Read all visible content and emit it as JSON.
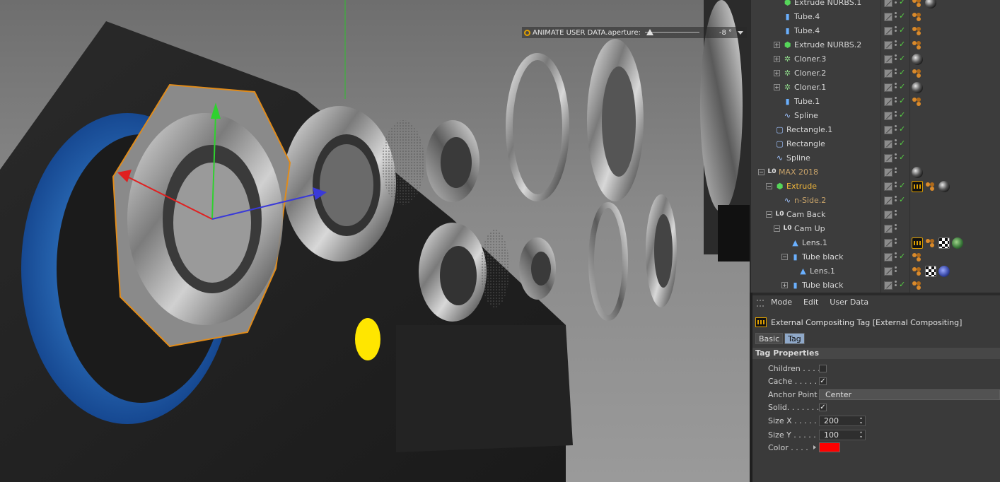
{
  "hud": {
    "label": "ANIMATE USER DATA.aperture:",
    "value": "-8 °",
    "slider_fraction": 0.02
  },
  "object_manager": {
    "rows": [
      {
        "name": "Extrude NURBS.1",
        "indent": 1,
        "icon": "extrude-icon",
        "expand": "",
        "check": true,
        "tags": [
          "dots",
          "sphere"
        ]
      },
      {
        "name": "Tube.4",
        "indent": 1,
        "icon": "tube-icon",
        "expand": "",
        "check": true,
        "tags": [
          "dots"
        ]
      },
      {
        "name": "Tube.4",
        "indent": 1,
        "icon": "tube-icon",
        "expand": "",
        "check": true,
        "tags": [
          "dots"
        ]
      },
      {
        "name": "Extrude NURBS.2",
        "indent": 1,
        "icon": "extrude-icon",
        "expand": "+",
        "check": true,
        "tags": [
          "dots"
        ]
      },
      {
        "name": "Cloner.3",
        "indent": 1,
        "icon": "cloner-icon",
        "expand": "+",
        "check": true,
        "tags": [
          "sphere"
        ]
      },
      {
        "name": "Cloner.2",
        "indent": 1,
        "icon": "cloner-icon",
        "expand": "+",
        "check": true,
        "tags": [
          "dots"
        ]
      },
      {
        "name": "Cloner.1",
        "indent": 1,
        "icon": "cloner-icon",
        "expand": "+",
        "check": true,
        "tags": [
          "sphere"
        ]
      },
      {
        "name": "Tube.1",
        "indent": 1,
        "icon": "tube-icon",
        "expand": "",
        "check": true,
        "tags": [
          "dots"
        ]
      },
      {
        "name": "Spline",
        "indent": 1,
        "icon": "spline-icon",
        "expand": "",
        "check": true,
        "tags": []
      },
      {
        "name": "Rectangle.1",
        "indent": 0,
        "icon": "rectangle-icon",
        "expand": "",
        "check": true,
        "tags": []
      },
      {
        "name": "Rectangle",
        "indent": 0,
        "icon": "rectangle-icon",
        "expand": "",
        "check": true,
        "tags": []
      },
      {
        "name": "Spline",
        "indent": 0,
        "icon": "spline-icon",
        "expand": "",
        "check": true,
        "tags": []
      },
      {
        "name": "MAX 2018",
        "indent": -1,
        "icon": "null-icon",
        "expand": "−",
        "check": false,
        "tags": [
          "sphere"
        ],
        "style": "dim"
      },
      {
        "name": "Extrude",
        "indent": 0,
        "icon": "extrude-icon",
        "expand": "−",
        "check": true,
        "tags": [
          "comp",
          "dots",
          "sphere"
        ],
        "style": "highlight"
      },
      {
        "name": "n-Side.2",
        "indent": 1,
        "icon": "spline-icon",
        "expand": "",
        "check": true,
        "tags": [],
        "style": "dim"
      },
      {
        "name": "Cam Back",
        "indent": 0,
        "icon": "null-icon",
        "expand": "−",
        "check": false,
        "tags": []
      },
      {
        "name": "Cam Up",
        "indent": 1,
        "icon": "null-icon",
        "expand": "−",
        "check": false,
        "tags": []
      },
      {
        "name": "Lens.1",
        "indent": 2,
        "icon": "lens-icon",
        "expand": "",
        "check": false,
        "tags": [
          "comp",
          "dots",
          "checker",
          "green"
        ]
      },
      {
        "name": "Tube black",
        "indent": 2,
        "icon": "tube-icon",
        "expand": "−",
        "check": true,
        "tags": [
          "dots"
        ]
      },
      {
        "name": "Lens.1",
        "indent": 3,
        "icon": "lens-icon",
        "expand": "",
        "check": false,
        "tags": [
          "dots",
          "checker",
          "blue"
        ]
      },
      {
        "name": "Tube black",
        "indent": 2,
        "icon": "tube-icon",
        "expand": "+",
        "check": true,
        "tags": [
          "dots"
        ]
      }
    ]
  },
  "attributes": {
    "menu": [
      "Mode",
      "Edit",
      "User Data"
    ],
    "title": "External Compositing Tag [External Compositing]",
    "tabs": [
      {
        "label": "Basic",
        "active": false
      },
      {
        "label": "Tag",
        "active": true
      }
    ],
    "section": "Tag Properties",
    "props": {
      "children_label": "Children . . . .",
      "children_checked": false,
      "cache_label": "Cache . . . . . .",
      "cache_checked": true,
      "anchor_label": "Anchor Point",
      "anchor_value": "Center",
      "solid_label": "Solid. . . . . . .",
      "solid_checked": true,
      "sizex_label": "Size X . . . . . .",
      "sizex_value": "200",
      "sizey_label": "Size Y . . . . . .",
      "sizey_value": "100",
      "color_label": "Color . . . .",
      "color_value": "#ff0000"
    }
  },
  "colors": {
    "highlight": "#f1b73a",
    "check": "#57d144",
    "accent": "#e0a000"
  }
}
